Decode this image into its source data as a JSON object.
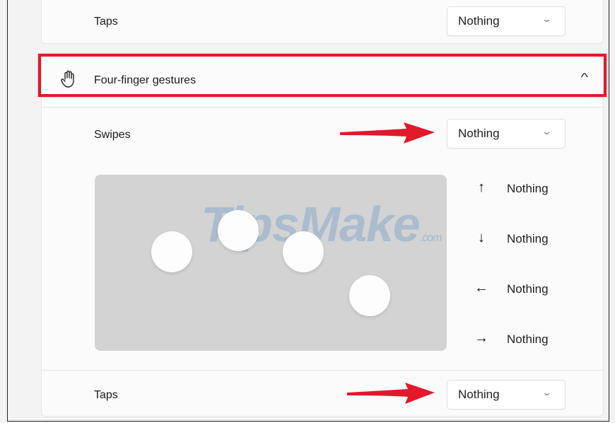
{
  "top_row": {
    "label": "Taps",
    "value": "Nothing"
  },
  "four_finger": {
    "header": "Four-finger gestures",
    "icon": "hand-icon",
    "swipes": {
      "label": "Swipes",
      "value": "Nothing"
    },
    "directions": [
      {
        "arrow": "↑",
        "value": "Nothing"
      },
      {
        "arrow": "↓",
        "value": "Nothing"
      },
      {
        "arrow": "←",
        "value": "Nothing"
      },
      {
        "arrow": "→",
        "value": "Nothing"
      }
    ],
    "taps": {
      "label": "Taps",
      "value": "Nothing"
    }
  },
  "watermark": {
    "brand": "TipsMake",
    "suffix": ".com"
  },
  "colors": {
    "highlight": "#e1192b",
    "annotation_arrow": "#e1192b"
  }
}
